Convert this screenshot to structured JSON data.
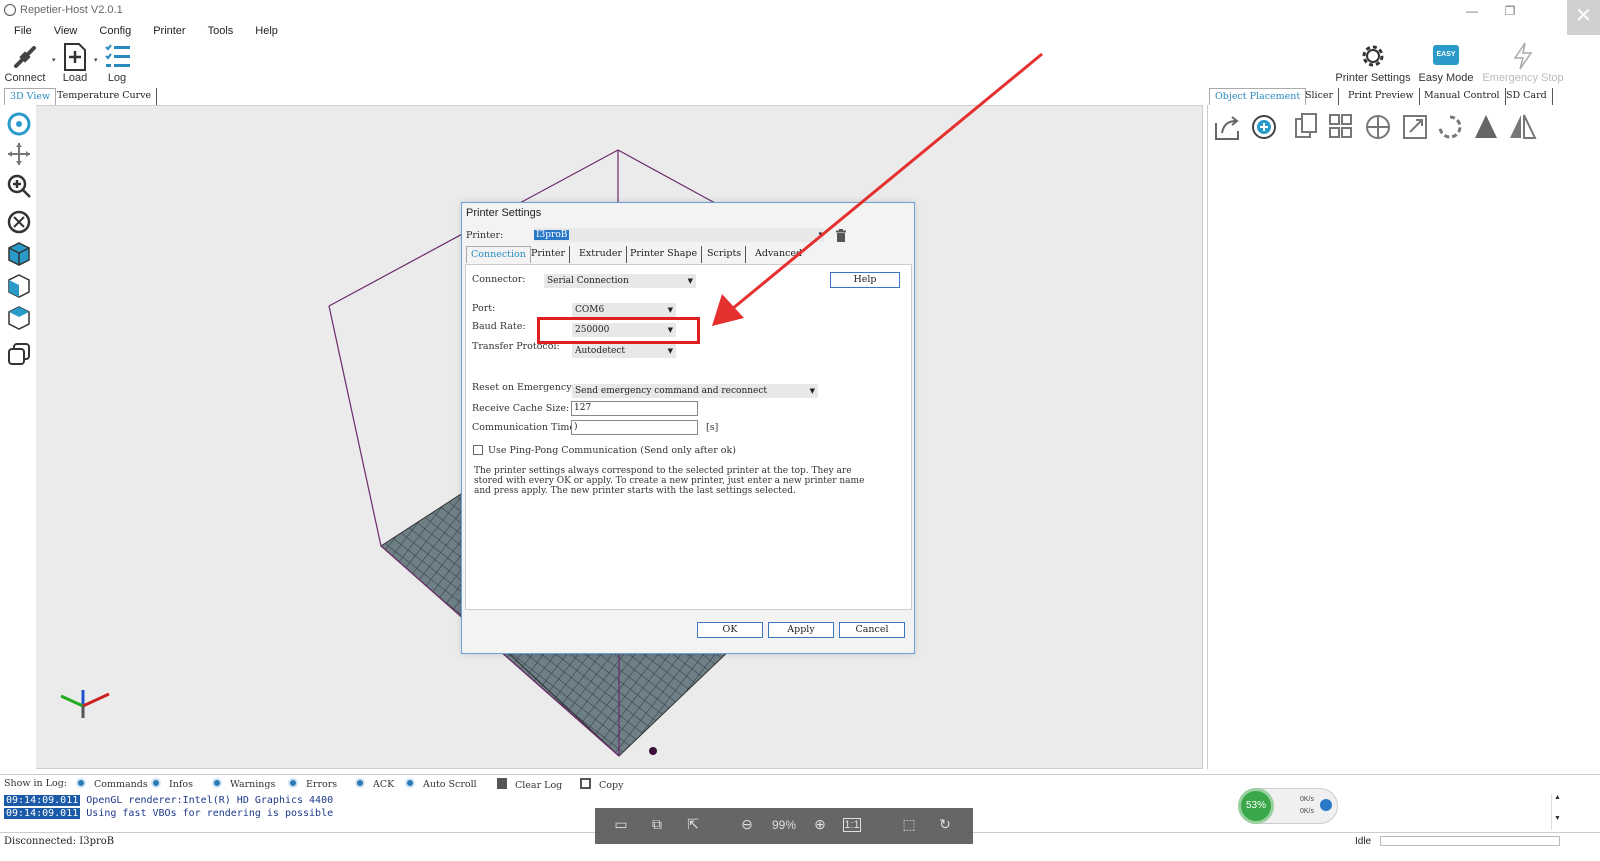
{
  "window": {
    "title": "Repetier-Host V2.0.1",
    "minimize": "—",
    "restore": "❐",
    "close": "✕"
  },
  "menu": [
    "File",
    "View",
    "Config",
    "Printer",
    "Tools",
    "Help"
  ],
  "toolbar": {
    "connect": "Connect",
    "load": "Load",
    "log": "Log",
    "printer_settings": "Printer Settings",
    "easy_mode": "Easy Mode",
    "easy_badge": "EASY",
    "emergency_stop": "Emergency Stop"
  },
  "left_tabs": [
    "3D View",
    "Temperature Curve"
  ],
  "right_tabs": [
    "Object Placement",
    "Slicer",
    "Print Preview",
    "Manual Control",
    "SD Card"
  ],
  "dialog": {
    "title": "Printer Settings",
    "printer_label": "Printer:",
    "printer_value": "I3proB",
    "tabs": [
      "Connection",
      "Printer",
      "Extruder",
      "Printer Shape",
      "Scripts",
      "Advanced"
    ],
    "connector_label": "Connector:",
    "connector_value": "Serial Connection",
    "help": "Help",
    "port_label": "Port:",
    "port_value": "COM6",
    "baud_label": "Baud Rate:",
    "baud_value": "250000",
    "protocol_label": "Transfer Protocol:",
    "protocol_value": "Autodetect",
    "reset_label": "Reset on Emergency",
    "reset_value": "Send emergency command and reconnect",
    "cache_label": "Receive Cache Size:",
    "cache_value": "127",
    "timeout_label": "Communication Timeout:",
    "timeout_value": ")",
    "timeout_unit": "[s]",
    "pingpong_label": "Use Ping-Pong Communication (Send only after ok)",
    "note": "The printer settings always correspond to the selected printer at the top. They are stored with every OK or apply. To create a new printer, just enter a new printer name and press apply. The new printer starts with the last settings selected.",
    "ok": "OK",
    "apply": "Apply",
    "cancel": "Cancel"
  },
  "log": {
    "show_label": "Show in Log:",
    "options": [
      "Commands",
      "Infos",
      "Warnings",
      "Errors",
      "ACK",
      "Auto Scroll"
    ],
    "clear": "Clear Log",
    "copy": "Copy",
    "rows": [
      {
        "time": "09:14:09.011",
        "text": "OpenGL renderer:Intel(R) HD Graphics 4400"
      },
      {
        "time": "09:14:09.011",
        "text": "Using fast VBOs for rendering is possible"
      }
    ]
  },
  "status": {
    "connection": "Disconnected: I3proB",
    "idle": "Idle"
  },
  "speed": {
    "percent": "53%",
    "up": "0K/s",
    "down": "0K/s"
  },
  "viewer": {
    "zoom": "99%",
    "one_to_one": "1:1"
  },
  "colors": {
    "accent": "#2a8ac0",
    "arrow": "#e53030",
    "highlight_box": "#e02020",
    "bed": "#6e7f86"
  }
}
